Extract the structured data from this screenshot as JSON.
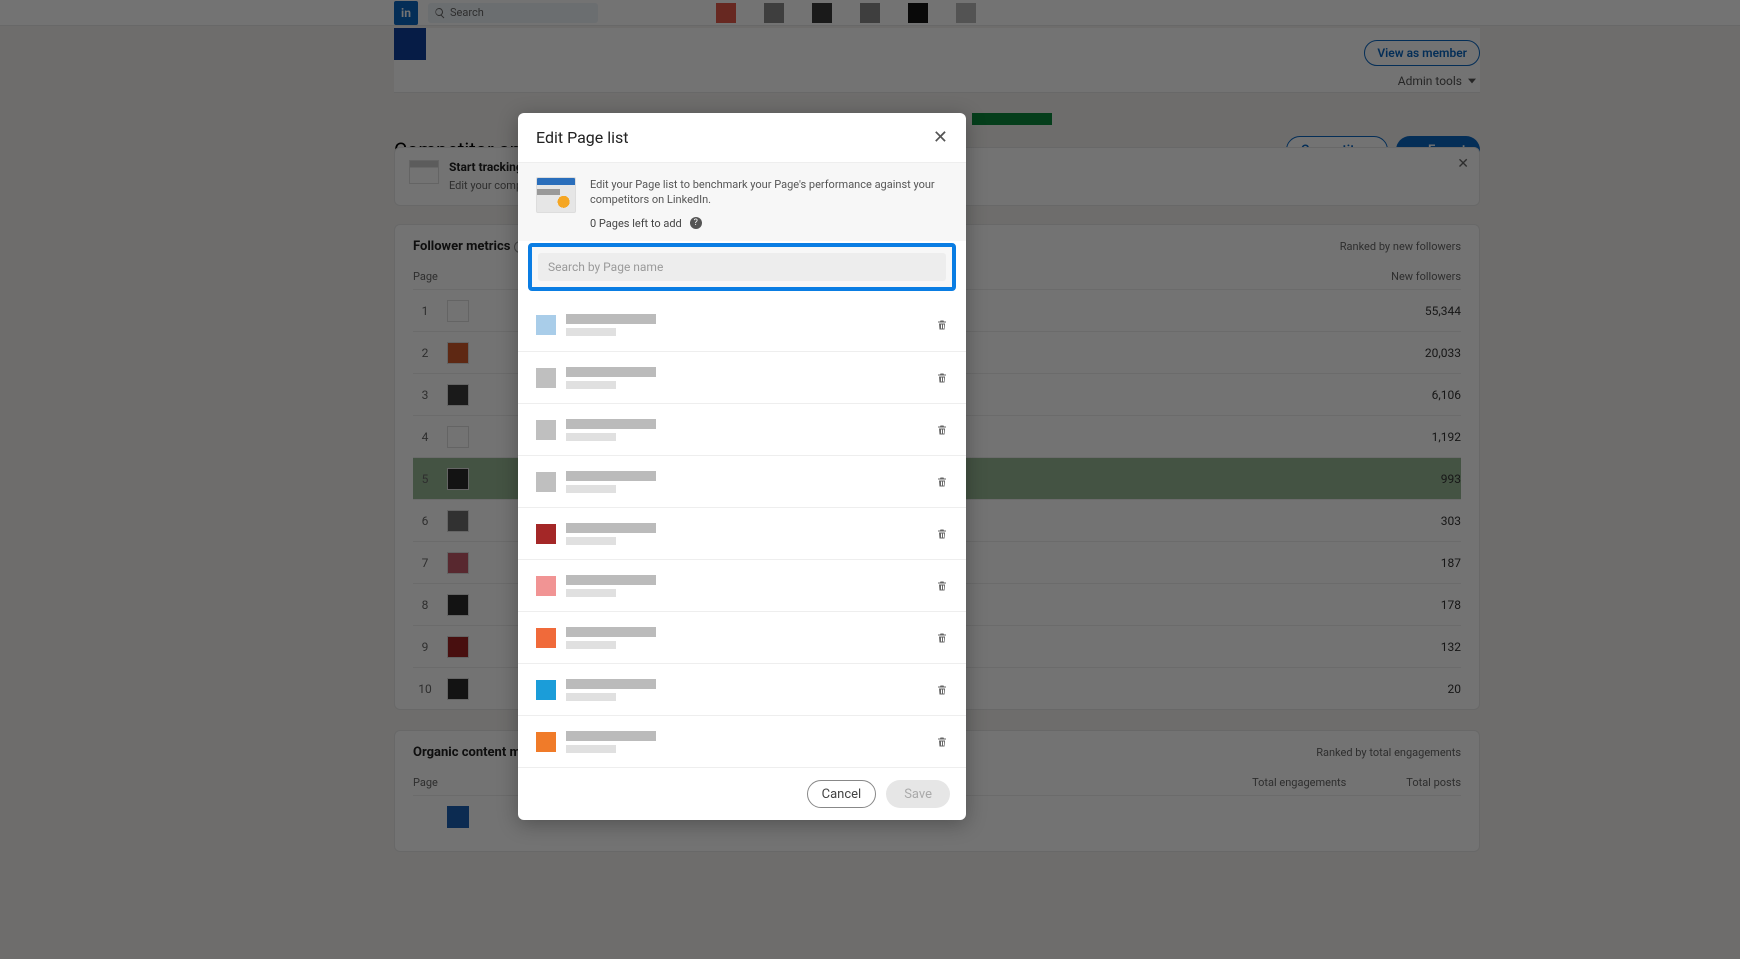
{
  "topnav": {
    "logo_text": "in",
    "search_placeholder": "Search"
  },
  "header": {
    "view_as_member": "View as member",
    "admin_tools": "Admin tools"
  },
  "title": "Competitor analytics",
  "buttons": {
    "competitors": "Competitors",
    "export": "Export"
  },
  "banner": {
    "title": "Start tracking",
    "subtitle": "Edit your competitor"
  },
  "follower_metrics": {
    "section_title": "Follower metrics",
    "ranked_by": "Ranked by new followers",
    "col_page": "Page",
    "col_new_followers": "New followers",
    "rows": [
      {
        "rank": "1",
        "color": "#ffffff",
        "value": "55,344"
      },
      {
        "rank": "2",
        "color": "#d15a2a",
        "value": "20,033"
      },
      {
        "rank": "3",
        "color": "#3a3a3a",
        "value": "6,106"
      },
      {
        "rank": "4",
        "color": "#ffffff",
        "value": "1,192"
      },
      {
        "rank": "5",
        "color": "#2b2b2b",
        "value": "993"
      },
      {
        "rank": "6",
        "color": "#6d6d6d",
        "value": "303"
      },
      {
        "rank": "7",
        "color": "#c35a68",
        "value": "187"
      },
      {
        "rank": "8",
        "color": "#2b2b2b",
        "value": "178"
      },
      {
        "rank": "9",
        "color": "#a02323",
        "value": "132"
      },
      {
        "rank": "10",
        "color": "#2b2b2b",
        "value": "20"
      }
    ]
  },
  "content_metrics": {
    "section_title": "Organic content metrics",
    "ranked_by": "Ranked by total engagements",
    "col_page": "Page",
    "col_engagements": "Total engagements",
    "col_posts": "Total posts"
  },
  "modal": {
    "title": "Edit Page list",
    "description": "Edit your Page list to benchmark your Page's performance against your competitors on LinkedIn.",
    "pages_left": "0 Pages left to add",
    "search_placeholder": "Search by Page name",
    "footer": {
      "cancel": "Cancel",
      "save": "Save"
    },
    "rows": [
      {
        "avatar_color": "#a9cde9"
      },
      {
        "avatar_color": "#bfbfbf"
      },
      {
        "avatar_color": "#bfbfbf"
      },
      {
        "avatar_color": "#bfbfbf"
      },
      {
        "avatar_color": "#a42727"
      },
      {
        "avatar_color": "#f19494"
      },
      {
        "avatar_color": "#f06a3a"
      },
      {
        "avatar_color": "#1b9dd9"
      },
      {
        "avatar_color": "#f07b29"
      }
    ]
  }
}
